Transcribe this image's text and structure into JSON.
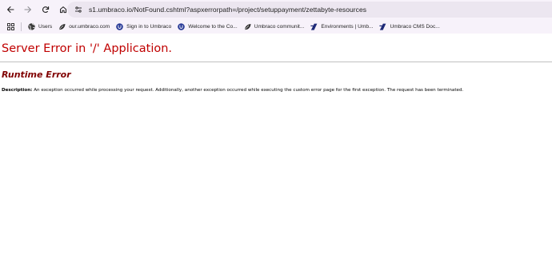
{
  "browser": {
    "address_bar": {
      "url": "s1.umbraco.io/NotFound.cshtml?aspxerrorpath=/project/setuppayment/zettabyte-resources"
    },
    "bookmarks": [
      {
        "label": "Users",
        "icon": "globe-icon"
      },
      {
        "label": "our.umbraco.com",
        "icon": "leaf-icon"
      },
      {
        "label": "Sign in to Umbraco",
        "icon": "umbraco-icon"
      },
      {
        "label": "Welcome to the Co...",
        "icon": "umbraco-icon"
      },
      {
        "label": "Umbraco communit...",
        "icon": "leaf-icon"
      },
      {
        "label": "Environments | Umb...",
        "icon": "flag-icon"
      },
      {
        "label": "Umbraco CMS Doc...",
        "icon": "flag-icon"
      }
    ]
  },
  "page": {
    "title": "Server Error in '/' Application.",
    "subtitle": "Runtime Error",
    "description_label": "Description:",
    "description_text": " An exception occurred while processing your request. Additionally, another exception occurred while executing the custom error page for the first exception. The request has been terminated."
  },
  "colors": {
    "title": "#c00000",
    "subtitle": "#800000",
    "chrome": "#f7f2fa",
    "omnibox": "#ece6f0"
  }
}
